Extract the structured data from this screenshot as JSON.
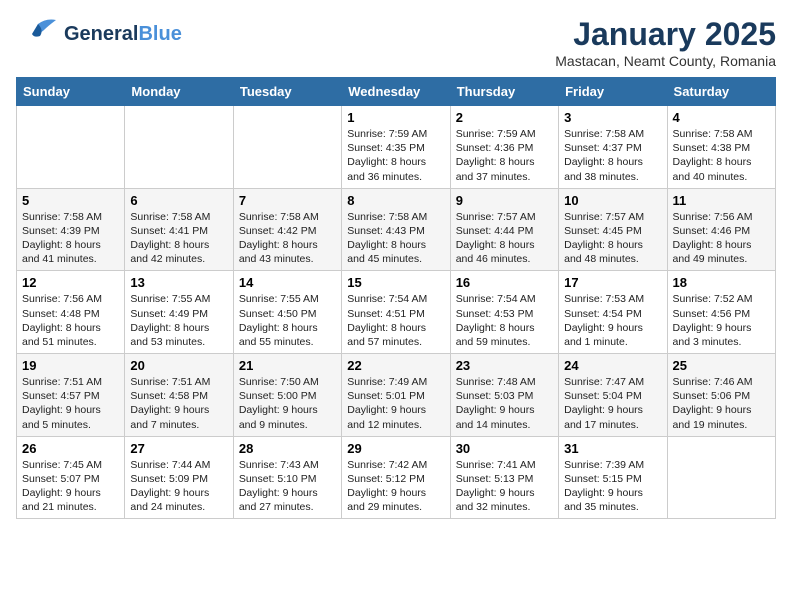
{
  "logo": {
    "line1": "General",
    "line2": "Blue"
  },
  "title": "January 2025",
  "subtitle": "Mastacan, Neamt County, Romania",
  "headers": [
    "Sunday",
    "Monday",
    "Tuesday",
    "Wednesday",
    "Thursday",
    "Friday",
    "Saturday"
  ],
  "weeks": [
    [
      {
        "day": "",
        "text": ""
      },
      {
        "day": "",
        "text": ""
      },
      {
        "day": "",
        "text": ""
      },
      {
        "day": "1",
        "text": "Sunrise: 7:59 AM\nSunset: 4:35 PM\nDaylight: 8 hours and 36 minutes."
      },
      {
        "day": "2",
        "text": "Sunrise: 7:59 AM\nSunset: 4:36 PM\nDaylight: 8 hours and 37 minutes."
      },
      {
        "day": "3",
        "text": "Sunrise: 7:58 AM\nSunset: 4:37 PM\nDaylight: 8 hours and 38 minutes."
      },
      {
        "day": "4",
        "text": "Sunrise: 7:58 AM\nSunset: 4:38 PM\nDaylight: 8 hours and 40 minutes."
      }
    ],
    [
      {
        "day": "5",
        "text": "Sunrise: 7:58 AM\nSunset: 4:39 PM\nDaylight: 8 hours and 41 minutes."
      },
      {
        "day": "6",
        "text": "Sunrise: 7:58 AM\nSunset: 4:41 PM\nDaylight: 8 hours and 42 minutes."
      },
      {
        "day": "7",
        "text": "Sunrise: 7:58 AM\nSunset: 4:42 PM\nDaylight: 8 hours and 43 minutes."
      },
      {
        "day": "8",
        "text": "Sunrise: 7:58 AM\nSunset: 4:43 PM\nDaylight: 8 hours and 45 minutes."
      },
      {
        "day": "9",
        "text": "Sunrise: 7:57 AM\nSunset: 4:44 PM\nDaylight: 8 hours and 46 minutes."
      },
      {
        "day": "10",
        "text": "Sunrise: 7:57 AM\nSunset: 4:45 PM\nDaylight: 8 hours and 48 minutes."
      },
      {
        "day": "11",
        "text": "Sunrise: 7:56 AM\nSunset: 4:46 PM\nDaylight: 8 hours and 49 minutes."
      }
    ],
    [
      {
        "day": "12",
        "text": "Sunrise: 7:56 AM\nSunset: 4:48 PM\nDaylight: 8 hours and 51 minutes."
      },
      {
        "day": "13",
        "text": "Sunrise: 7:55 AM\nSunset: 4:49 PM\nDaylight: 8 hours and 53 minutes."
      },
      {
        "day": "14",
        "text": "Sunrise: 7:55 AM\nSunset: 4:50 PM\nDaylight: 8 hours and 55 minutes."
      },
      {
        "day": "15",
        "text": "Sunrise: 7:54 AM\nSunset: 4:51 PM\nDaylight: 8 hours and 57 minutes."
      },
      {
        "day": "16",
        "text": "Sunrise: 7:54 AM\nSunset: 4:53 PM\nDaylight: 8 hours and 59 minutes."
      },
      {
        "day": "17",
        "text": "Sunrise: 7:53 AM\nSunset: 4:54 PM\nDaylight: 9 hours and 1 minute."
      },
      {
        "day": "18",
        "text": "Sunrise: 7:52 AM\nSunset: 4:56 PM\nDaylight: 9 hours and 3 minutes."
      }
    ],
    [
      {
        "day": "19",
        "text": "Sunrise: 7:51 AM\nSunset: 4:57 PM\nDaylight: 9 hours and 5 minutes."
      },
      {
        "day": "20",
        "text": "Sunrise: 7:51 AM\nSunset: 4:58 PM\nDaylight: 9 hours and 7 minutes."
      },
      {
        "day": "21",
        "text": "Sunrise: 7:50 AM\nSunset: 5:00 PM\nDaylight: 9 hours and 9 minutes."
      },
      {
        "day": "22",
        "text": "Sunrise: 7:49 AM\nSunset: 5:01 PM\nDaylight: 9 hours and 12 minutes."
      },
      {
        "day": "23",
        "text": "Sunrise: 7:48 AM\nSunset: 5:03 PM\nDaylight: 9 hours and 14 minutes."
      },
      {
        "day": "24",
        "text": "Sunrise: 7:47 AM\nSunset: 5:04 PM\nDaylight: 9 hours and 17 minutes."
      },
      {
        "day": "25",
        "text": "Sunrise: 7:46 AM\nSunset: 5:06 PM\nDaylight: 9 hours and 19 minutes."
      }
    ],
    [
      {
        "day": "26",
        "text": "Sunrise: 7:45 AM\nSunset: 5:07 PM\nDaylight: 9 hours and 21 minutes."
      },
      {
        "day": "27",
        "text": "Sunrise: 7:44 AM\nSunset: 5:09 PM\nDaylight: 9 hours and 24 minutes."
      },
      {
        "day": "28",
        "text": "Sunrise: 7:43 AM\nSunset: 5:10 PM\nDaylight: 9 hours and 27 minutes."
      },
      {
        "day": "29",
        "text": "Sunrise: 7:42 AM\nSunset: 5:12 PM\nDaylight: 9 hours and 29 minutes."
      },
      {
        "day": "30",
        "text": "Sunrise: 7:41 AM\nSunset: 5:13 PM\nDaylight: 9 hours and 32 minutes."
      },
      {
        "day": "31",
        "text": "Sunrise: 7:39 AM\nSunset: 5:15 PM\nDaylight: 9 hours and 35 minutes."
      },
      {
        "day": "",
        "text": ""
      }
    ]
  ]
}
